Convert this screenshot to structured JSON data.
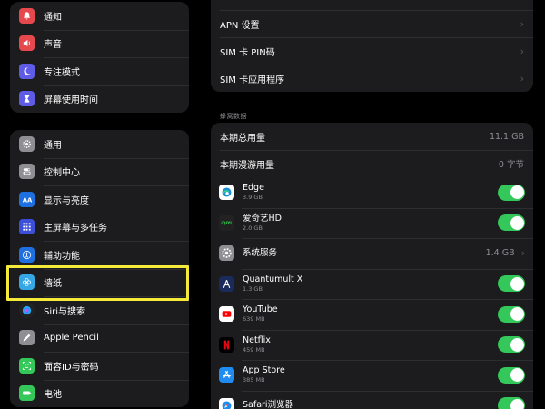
{
  "settings_sidebar": {
    "group1": [
      {
        "label": "通知",
        "icon": "bell-icon",
        "color": "#e5484d"
      },
      {
        "label": "声音",
        "icon": "speaker-icon",
        "color": "#e5484d"
      },
      {
        "label": "专注模式",
        "icon": "moon-icon",
        "color": "#5e5ce6"
      },
      {
        "label": "屏幕使用时间",
        "icon": "hourglass-icon",
        "color": "#5e5ce6"
      }
    ],
    "group2": [
      {
        "label": "通用",
        "icon": "gear-icon",
        "color": "#8e8e93"
      },
      {
        "label": "控制中心",
        "icon": "switches-icon",
        "color": "#8e8e93"
      },
      {
        "label": "显示与亮度",
        "icon": "aa-icon",
        "color": "#1e6fe0"
      },
      {
        "label": "主屏幕与多任务",
        "icon": "grid-icon",
        "color": "#3b4fd8"
      },
      {
        "label": "辅助功能",
        "icon": "accessibility-icon",
        "color": "#1e6fe0"
      },
      {
        "label": "墙纸",
        "icon": "flower-icon",
        "color": "#35a6e6"
      },
      {
        "label": "Siri与搜索",
        "icon": "siri-icon",
        "color": "#222222"
      },
      {
        "label": "Apple Pencil",
        "icon": "pencil-icon",
        "color": "#8e8e93"
      },
      {
        "label": "面容ID与密码",
        "icon": "faceid-icon",
        "color": "#34c759"
      },
      {
        "label": "电池",
        "icon": "battery-icon",
        "color": "#34c759"
      }
    ]
  },
  "cellular": {
    "top_rows": [
      {
        "label": "APN 设置"
      },
      {
        "label": "SIM 卡 PIN码"
      },
      {
        "label": "SIM 卡应用程序"
      }
    ],
    "section_header": "蜂窝数据",
    "usage_rows": [
      {
        "label": "本期总用量",
        "value": "11.1 GB"
      },
      {
        "label": "本期漫游用量",
        "value": "0 字节"
      }
    ],
    "apps": [
      {
        "name": "Edge",
        "size": "3.9 GB",
        "icon": "edge-icon",
        "color": "#ffffff",
        "toggle": true
      },
      {
        "name": "爱奇艺HD",
        "size": "2.0 GB",
        "icon": "iqiyi-icon",
        "color": "#222222",
        "toggle": true
      },
      {
        "name": "系统服务",
        "size": "",
        "value": "1.4 GB",
        "icon": "gear-icon",
        "color": "#8e8e93",
        "toggle": false
      },
      {
        "name": "Quantumult X",
        "size": "1.3 GB",
        "icon": "quantumult-icon",
        "color": "#1a2a5a",
        "toggle": true
      },
      {
        "name": "YouTube",
        "size": "639 MB",
        "icon": "youtube-icon",
        "color": "#ffffff",
        "toggle": true
      },
      {
        "name": "Netflix",
        "size": "459 MB",
        "icon": "netflix-icon",
        "color": "#000000",
        "toggle": true
      },
      {
        "name": "App Store",
        "size": "385 MB",
        "icon": "appstore-icon",
        "color": "#1e8cf0",
        "toggle": true
      },
      {
        "name": "Safari浏览器",
        "size": "",
        "icon": "safari-icon",
        "color": "#ffffff",
        "toggle": true
      }
    ]
  }
}
